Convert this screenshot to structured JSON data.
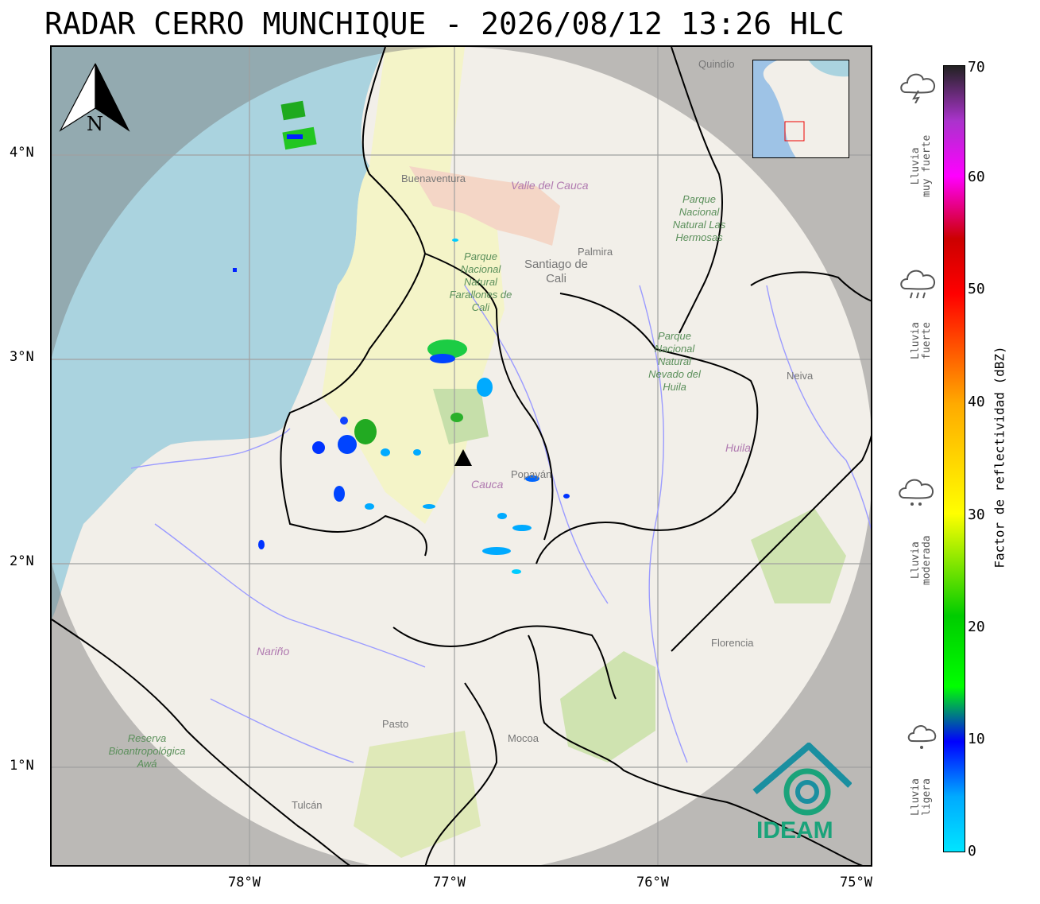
{
  "title": "RADAR CERRO MUNCHIQUE - 2026/08/12 13:26 HLC",
  "lat_labels": [
    "4°N",
    "3°N",
    "2°N",
    "1°N"
  ],
  "lon_labels": [
    "78°W",
    "77°W",
    "76°W",
    "75°W"
  ],
  "north_arrow": {
    "label": "N",
    "icon": "north-arrow-icon"
  },
  "colorbar": {
    "label": "Factor de reflectividad (dBZ)",
    "ticks": [
      "70",
      "60",
      "50",
      "40",
      "30",
      "20",
      "10",
      "0"
    ],
    "colors": [
      "#00e5ff",
      "#0000ff",
      "#00ff00",
      "#ffff00",
      "#ff0000",
      "#ff00ff",
      "#222222"
    ]
  },
  "categories": [
    {
      "line1": "Lluvia",
      "line2": "muy fuerte",
      "icon": "storm-cloud-icon"
    },
    {
      "line1": "Lluvia",
      "line2": "fuerte",
      "icon": "heavy-rain-cloud-icon"
    },
    {
      "line1": "Lluvia",
      "line2": "moderada",
      "icon": "rain-cloud-icon"
    },
    {
      "line1": "Lluvia",
      "line2": "ligera",
      "icon": "light-rain-cloud-icon"
    }
  ],
  "logo": {
    "text": "IDEAM"
  },
  "places": {
    "buenaventura": "Buenaventura",
    "valle": "Valle del Cauca",
    "palmira": "Palmira",
    "cali": "Santiago de Cali",
    "neiva": "Neiva",
    "huila": "Huila",
    "popayan": "Popayán",
    "cauca": "Cauca",
    "narino": "Nariño",
    "pasto": "Pasto",
    "mocoa": "Mocoa",
    "florencia": "Florencia",
    "tulcan": "Tulcán",
    "quindio": "Quindío"
  },
  "parks": {
    "farallones": "Parque Nacional Natural Farallones de Cali",
    "hermosas": "Parque Nacional Natural Las Hermosas",
    "huila_park": "Parque Nacional Natural Nevado del Huila",
    "awa": "Reserva Bioantropológica Awá"
  }
}
